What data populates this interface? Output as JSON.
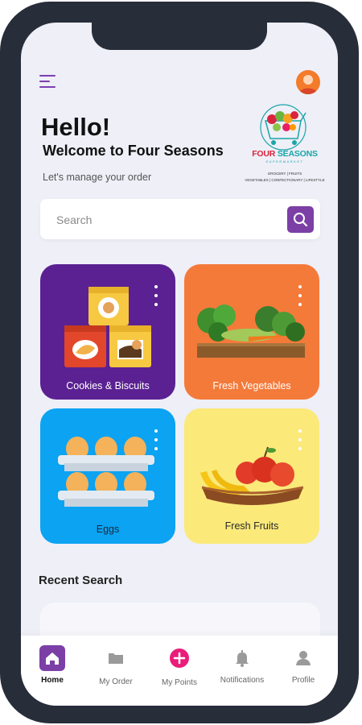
{
  "greeting": {
    "hello": "Hello!",
    "welcome": "Welcome to Four Seasons",
    "subtitle": "Let's manage your order"
  },
  "logo": {
    "name_part1": "FOUR",
    "name_part2": "SEASONS",
    "tagline": "SUPERMARKET",
    "line1": "GROCERY | FRUITS",
    "line2": "VEGETABLES | CONFECTIONARY | LIFESTYLE"
  },
  "search": {
    "placeholder": "Search",
    "value": ""
  },
  "categories": [
    {
      "label": "Cookies & Biscuits",
      "color": "#5b2192"
    },
    {
      "label": "Fresh Vegetables",
      "color": "#f47a3a"
    },
    {
      "label": "Eggs",
      "color": "#0ba3f2"
    },
    {
      "label": "Fresh Fruits",
      "color": "#fbe97a"
    }
  ],
  "recent": {
    "title": "Recent Search"
  },
  "nav": {
    "items": [
      {
        "label": "Home",
        "icon": "home-icon"
      },
      {
        "label": "My Order",
        "icon": "folder-icon"
      },
      {
        "label": "My Points",
        "icon": "plus-circle-icon"
      },
      {
        "label": "Notifications",
        "icon": "bell-icon"
      },
      {
        "label": "Profile",
        "icon": "user-icon"
      }
    ]
  },
  "colors": {
    "accent": "#7b3fa6",
    "points": "#e91e7a",
    "frame": "#272d39",
    "background": "#eeeff7"
  }
}
